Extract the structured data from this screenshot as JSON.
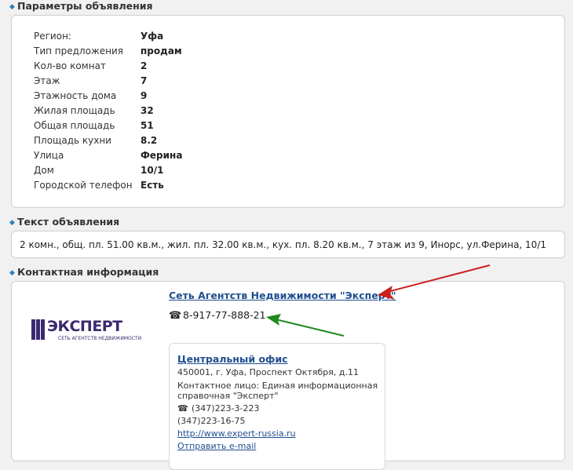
{
  "params": {
    "title": "Параметры объявления",
    "rows": [
      {
        "label": "Регион:",
        "value": "Уфа"
      },
      {
        "label": "Тип предложения",
        "value": "продам"
      },
      {
        "label": "Кол-во комнат",
        "value": "2"
      },
      {
        "label": "Этаж",
        "value": "7"
      },
      {
        "label": "Этажность дома",
        "value": "9"
      },
      {
        "label": "Жилая площадь",
        "value": "32"
      },
      {
        "label": "Общая площадь",
        "value": "51"
      },
      {
        "label": "Площадь кухни",
        "value": "8.2"
      },
      {
        "label": "Улица",
        "value": "Ферина"
      },
      {
        "label": "Дом",
        "value": "10/1"
      },
      {
        "label": "Городской телефон",
        "value": "Есть"
      }
    ]
  },
  "adtext": {
    "title": "Текст объявления",
    "body": "2 комн., общ. пл. 51.00 кв.м., жил. пл. 32.00 кв.м., кух. пл. 8.20 кв.м., 7 этаж из 9, Инорс, ул.Ферина, 10/1"
  },
  "contact": {
    "title": "Контактная информация",
    "agency_name": "Сеть Агентств Недвижимости \"Эксперт\"",
    "phone": "8-917-77-888-21",
    "logo_text": "ЭКСПЕРТ",
    "logo_subtext": "СЕТЬ АГЕНТСТВ НЕДВИЖИМОСТИ",
    "office": {
      "title": "Центральный офис",
      "address": "450001, г. Уфа, Проспект Октября, д.11",
      "contact_line1": "Контактное лицо: Единая информационная",
      "contact_line2": "справочная \"Эксперт\"",
      "phone1": "(347)223-3-223",
      "phone2": "(347)223-16-75",
      "website": "http://www.expert-russia.ru",
      "send_email": "Отправить e-mail"
    }
  },
  "colors": {
    "link": "#1f4f8f",
    "bullet": "#2a7fc0",
    "red_arrow": "#cc1f1f",
    "green_arrow": "#1f8a1f"
  }
}
